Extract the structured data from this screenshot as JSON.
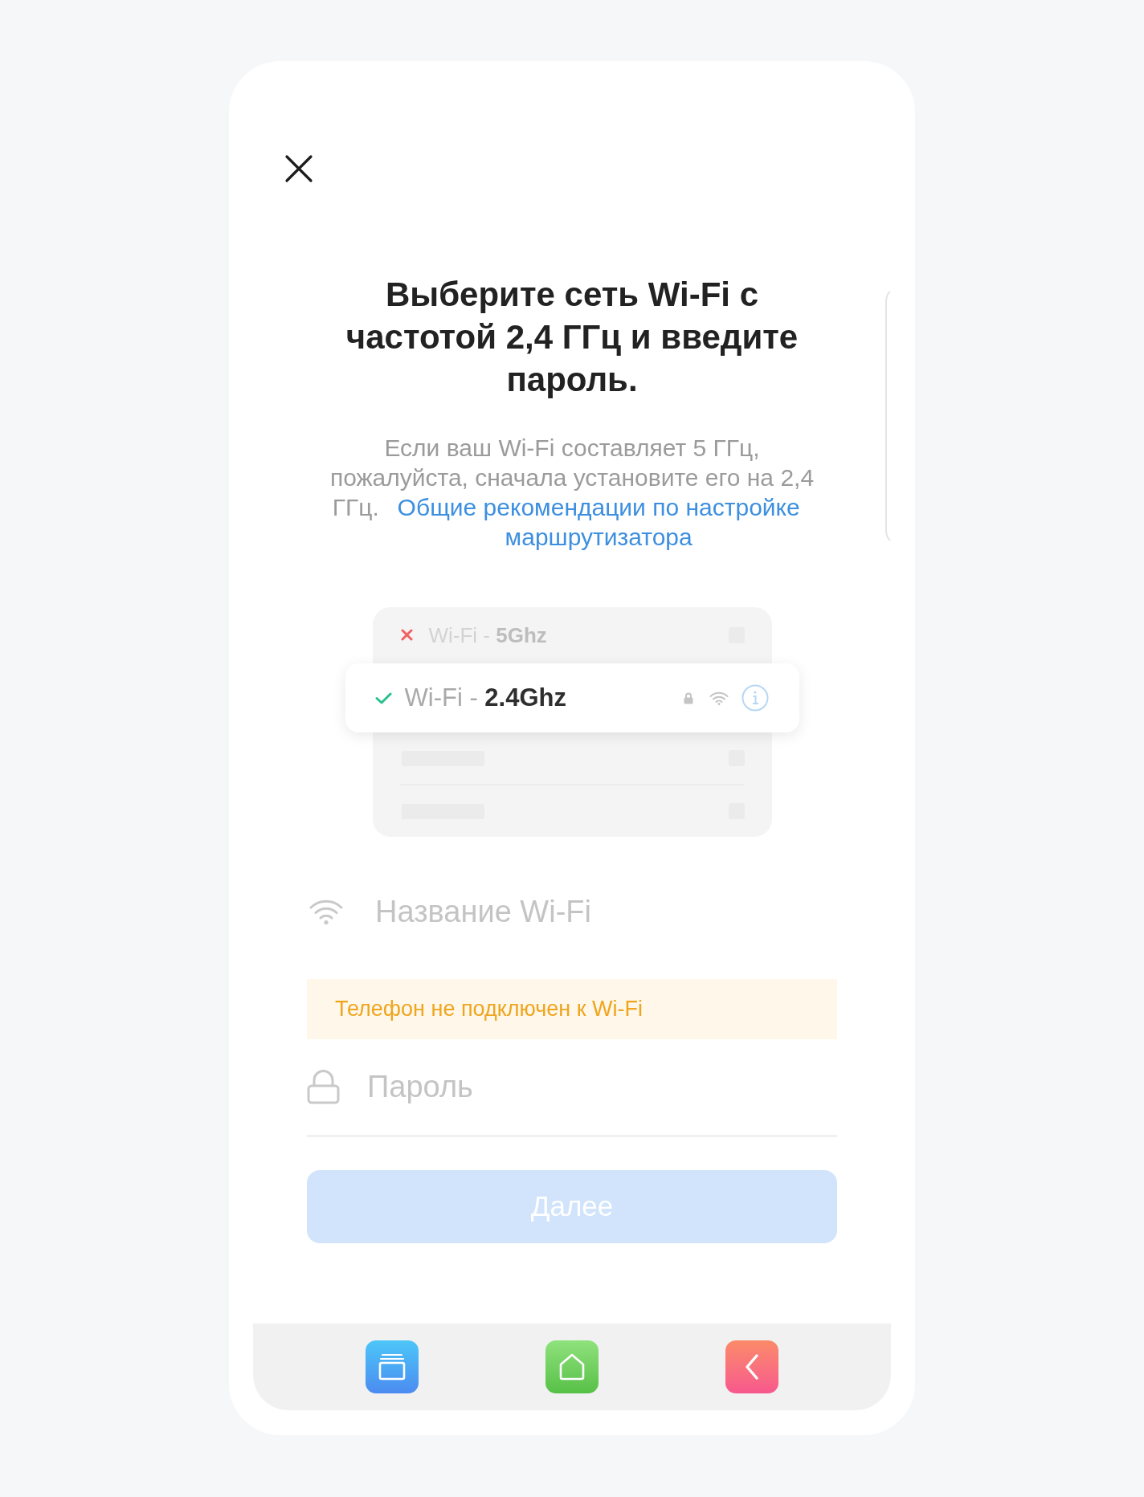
{
  "title": "Выберите сеть Wi-Fi с частотой 2,4 ГГц и введите пароль.",
  "description": {
    "text": "Если ваш Wi-Fi составляет 5 ГГц, пожалуйста, сначала установите его на 2,4 ГГц.",
    "link": "Общие рекомендации по настройке маршрутизатора"
  },
  "illustration": {
    "networks": [
      {
        "kind": "unsupported",
        "label": "Wi-Fi - **5Ghz**"
      },
      {
        "kind": "supported",
        "label": "Wi-Fi - **2.4Ghz**"
      }
    ]
  },
  "wifi_field": {
    "placeholder": "Название Wi-Fi"
  },
  "warning": {
    "text": "Телефон не подключен к Wi-Fi"
  },
  "password_field": {
    "placeholder": "Пароль"
  },
  "next_button": {
    "label": "Далее",
    "disabled": true
  }
}
